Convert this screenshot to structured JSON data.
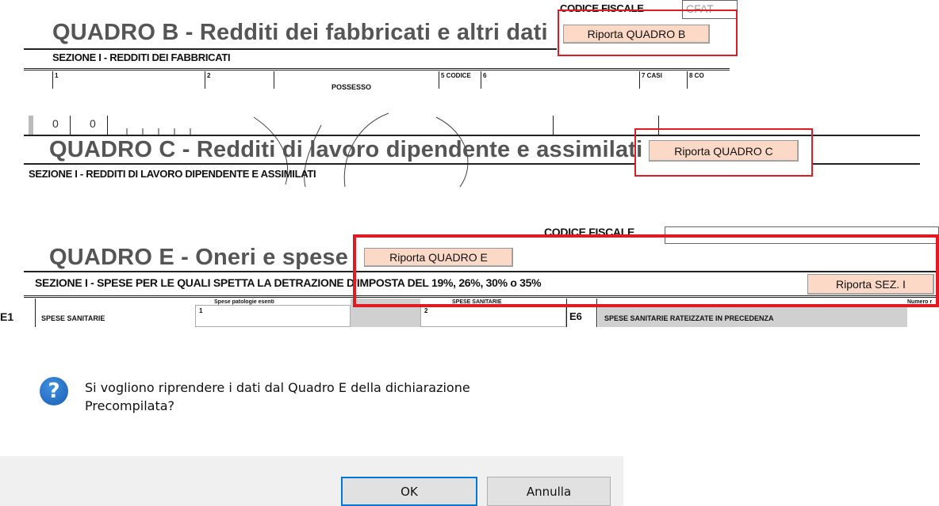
{
  "quadro_b": {
    "title": "QUADRO B - Redditi dei fabbricati e altri dati",
    "button": "Riporta QUADRO B",
    "codice_fiscale_label": "CODICE FISCALE",
    "codice_fiscale_value": "CFAT",
    "section": "SEZIONE I - REDDITI DEI FABBRICATI",
    "columns": [
      "1",
      "2",
      "POSSESSO",
      "5 CODICE",
      "6",
      "7 CASI",
      "8 CO"
    ]
  },
  "quadro_c": {
    "row_values": [
      "0",
      "0"
    ],
    "title": "QUADRO C - Redditi di lavoro dipendente e assimilati",
    "button": "Riporta QUADRO C",
    "section": "SEZIONE I - REDDITI DI LAVORO DIPENDENTE E ASSIMILATI"
  },
  "quadro_e": {
    "title": "QUADRO E - Oneri e spese",
    "button": "Riporta QUADRO E",
    "codice_fiscale_label": "CODICE FISCALE",
    "section": "SEZIONE I - SPESE PER LE QUALI SPETTA LA DETRAZIONE D'IMPOSTA DEL 19%, 26%, 30% o 35%",
    "section_button": "Riporta SEZ. I",
    "row_code": "E1",
    "row_label": "SPESE SANITARIE",
    "col_patologie": "Spese patologie esenti",
    "col_sanitarie": "SPESE SANITARIE",
    "col_numero": "Numero r",
    "field_1": "1",
    "field_2": "2",
    "e6_code": "E6",
    "e6_label": "SPESE SANITARIE RATEIZZATE IN PRECEDENZA"
  },
  "dialog": {
    "icon": "question-icon",
    "message_line1": "Si vogliono riprendere i dati dal Quadro E della dichiarazione",
    "message_line2": "Precompilata?",
    "ok_label": "OK",
    "cancel_label": "Annulla"
  },
  "colors": {
    "highlight": "#e01b24",
    "button_bg": "#fcd9c7",
    "title_gray": "#555555"
  }
}
